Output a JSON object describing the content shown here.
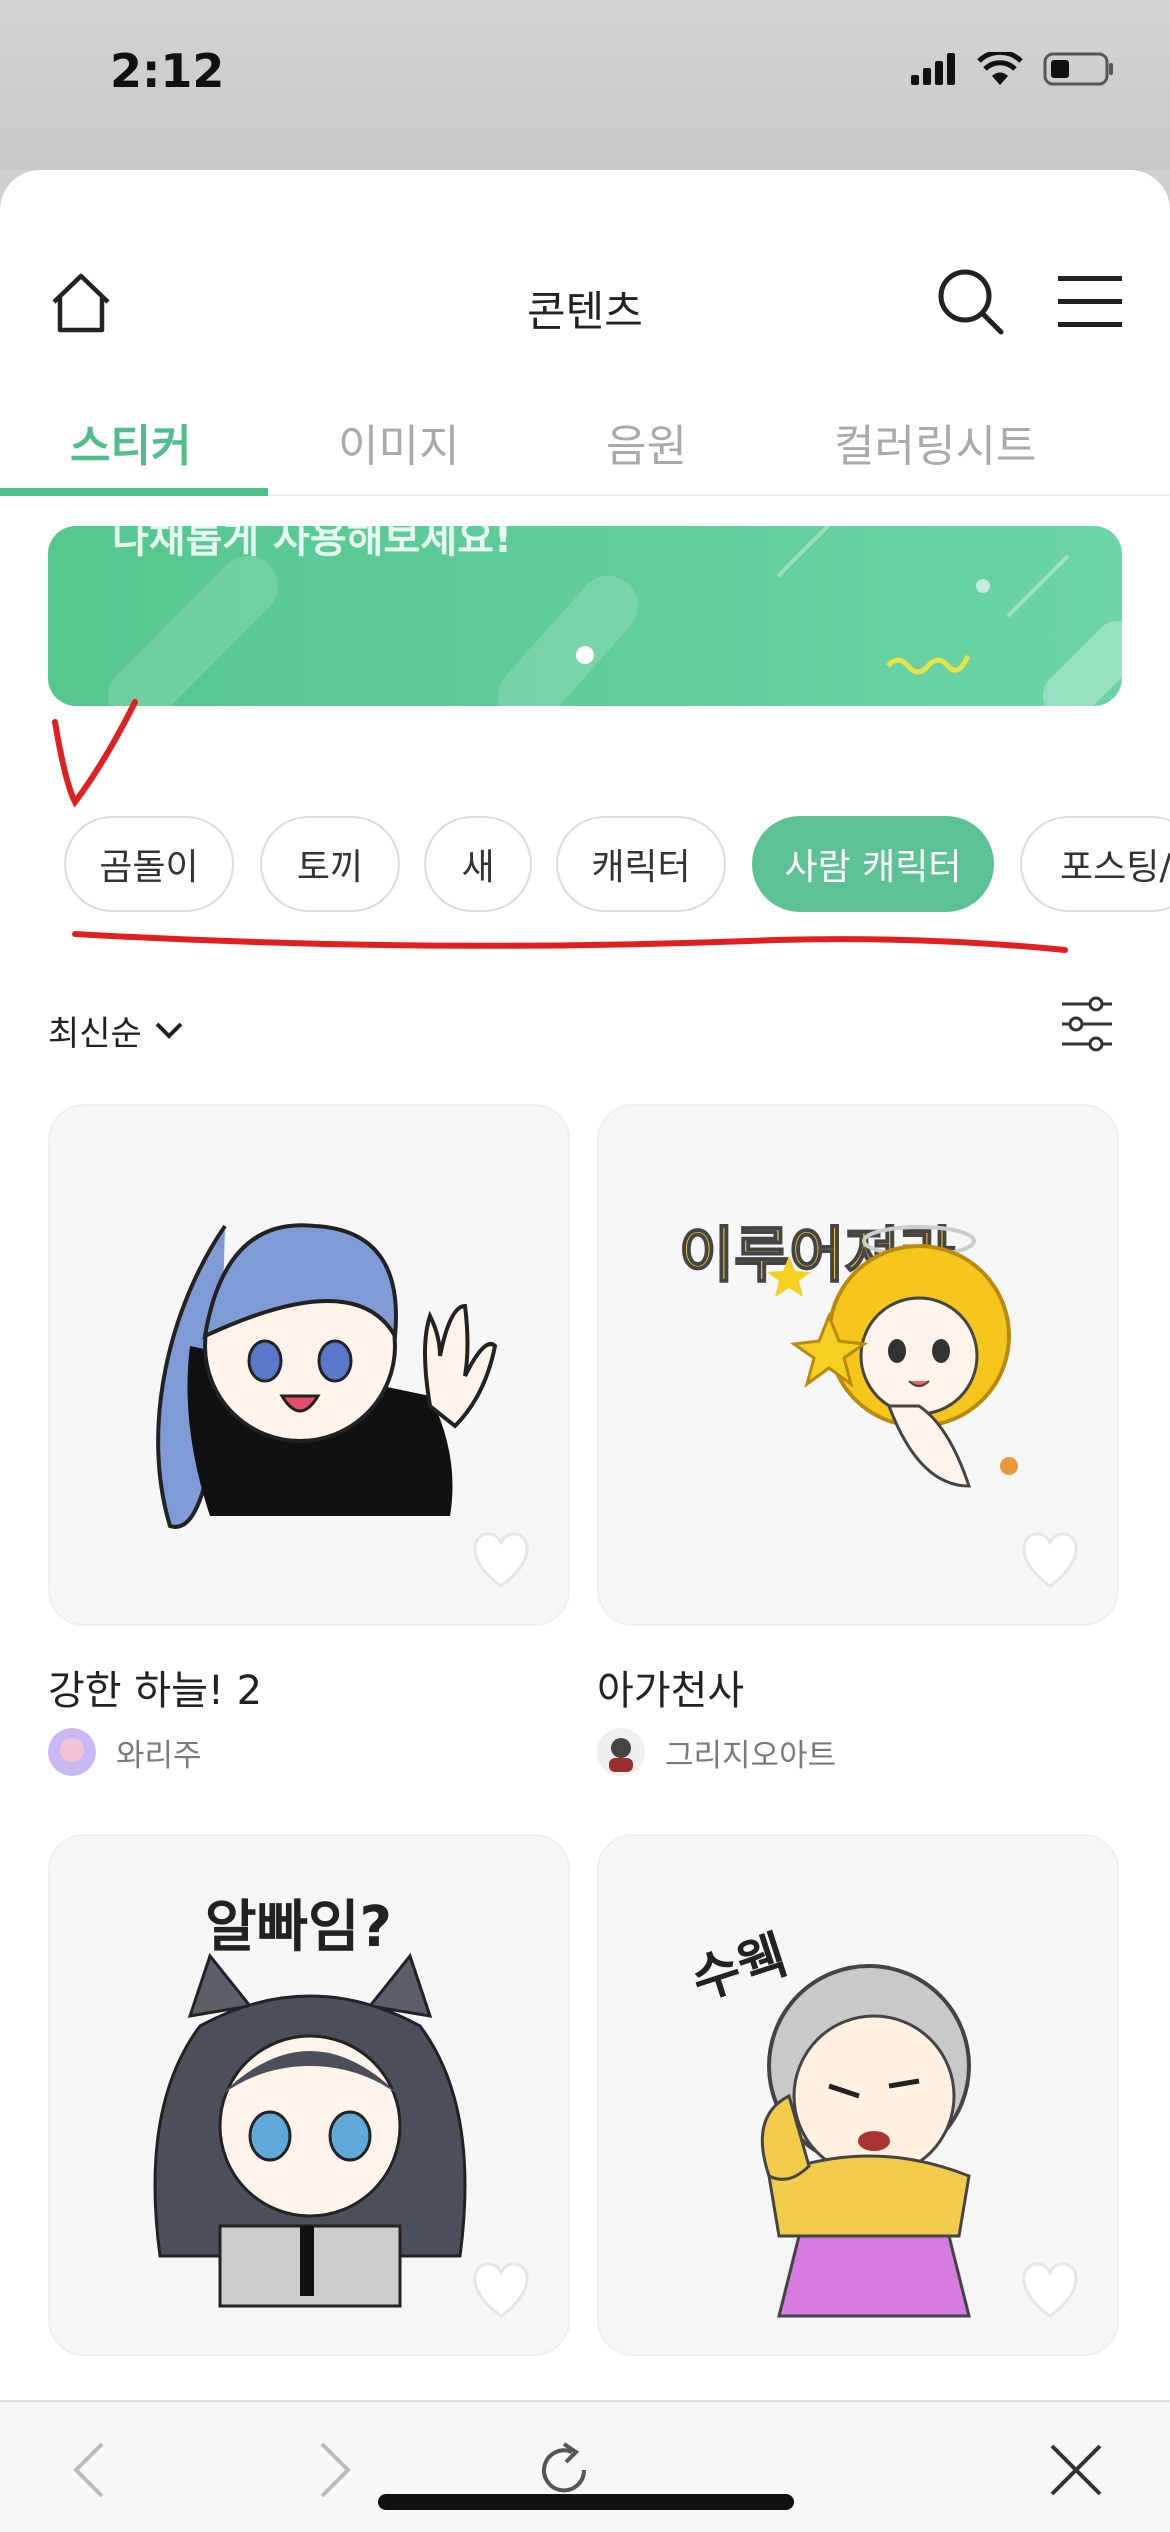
{
  "status": {
    "time": "2:12"
  },
  "header": {
    "title": "콘텐츠"
  },
  "tabs": [
    {
      "label": "스티커",
      "active": true
    },
    {
      "label": "이미지",
      "active": false
    },
    {
      "label": "음원",
      "active": false
    },
    {
      "label": "컬러링시트",
      "active": false
    }
  ],
  "banner": {
    "text": "다채롭게 사용해보세요!"
  },
  "chips": [
    {
      "label": "곰돌이",
      "active": false
    },
    {
      "label": "토끼",
      "active": false
    },
    {
      "label": "새",
      "active": false
    },
    {
      "label": "캐릭터",
      "active": false
    },
    {
      "label": "사람 캐릭터",
      "active": true
    },
    {
      "label": "포스팅/",
      "active": false
    }
  ],
  "sort": {
    "label": "최신순"
  },
  "cards": [
    {
      "title": "강한 하늘! 2",
      "author": "와리주"
    },
    {
      "title": "아가천사",
      "author": "그리지오아트"
    },
    {
      "title": "",
      "author": ""
    },
    {
      "title": "",
      "author": ""
    }
  ],
  "stickers": {
    "angel_text": "이루어져라",
    "wolf_text": "알빠임?",
    "grandma_text": "수웩"
  },
  "colors": {
    "accent": "#4fbf8a",
    "annotation": "#e02020"
  }
}
